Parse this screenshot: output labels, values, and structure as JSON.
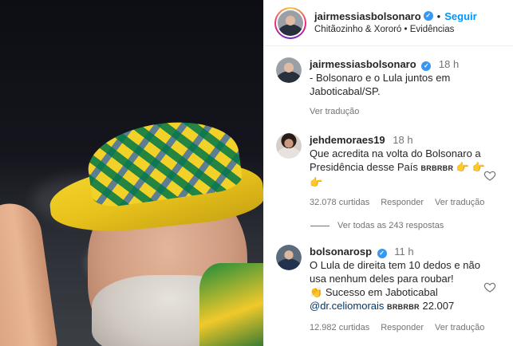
{
  "post": {
    "username": "jairmessiasbolsonaro",
    "follow_label": "Seguir",
    "dot": "•",
    "audio": "Chitãozinho & Xororó",
    "audio_sep": "•",
    "audio_tag": "Evidências"
  },
  "caption": {
    "username": "jairmessiasbolsonaro",
    "time": "18 h",
    "text": "- Bolsonaro e o Lula juntos em Jaboticabal/SP.",
    "translate_label": "Ver tradução"
  },
  "comments": [
    {
      "username": "jehdemoraes19",
      "time": "18 h",
      "text": "Que acredita na volta do Bolsonaro a Presidência desse País",
      "tags": "BRBRBR",
      "emojis": "👉 👉 👉",
      "likes": "32.078 curtidas",
      "reply_label": "Responder",
      "translate_label": "Ver tradução"
    },
    {
      "username": "bolsonarosp",
      "time": "11 h",
      "text": "O Lula de direita tem 10 dedos e não usa nenhum deles para roubar!",
      "emoji": "👏",
      "text2": "Sucesso em Jaboticabal",
      "mention": "@dr.celiomorais",
      "tags": "BRBRBR",
      "count": "22.007",
      "likes": "12.982 curtidas",
      "reply_label": "Responder",
      "translate_label": "Ver tradução"
    }
  ],
  "view_replies_label": "Ver todas as 243 respostas",
  "colors": {
    "follow": "#0095f6",
    "verified": "#3897f0",
    "muted": "#737373",
    "text": "#262626"
  },
  "icons": [
    "verified-badge-icon",
    "heart-icon"
  ]
}
